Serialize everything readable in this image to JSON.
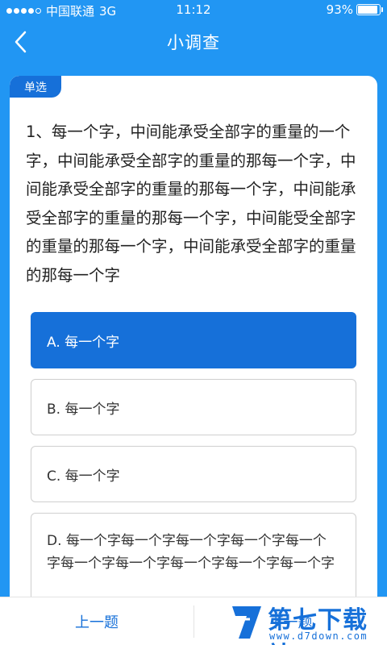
{
  "status_bar": {
    "carrier": "中国联通",
    "network": "3G",
    "time": "11:12",
    "battery": "93%",
    "battery_level": 0.93
  },
  "header": {
    "title": "小调查"
  },
  "question": {
    "type_tag": "单选",
    "text": "1、每一个字，中间能承受全部字的重量的一个字，中间能承受全部字的重量的那每一个字，中间能承受全部字的重量的那每一个字，中间能承受全部字的重量的那每一个字，中间能受全部字的重量的那每一个字，中间能承受全部字的重量的那每一个字"
  },
  "options": [
    {
      "label": "A. 每一个字",
      "selected": true
    },
    {
      "label": "B. 每一个字",
      "selected": false
    },
    {
      "label": "C. 每一个字",
      "selected": false
    },
    {
      "label": "D. 每一个字每一个字每一个字每一个字每一个字每一个字每一个字每一个字每一个字每一个字",
      "selected": false
    }
  ],
  "footer": {
    "prev_label": "上一题",
    "next_label": "下一题"
  },
  "watermark": {
    "title": "第七下载站",
    "url": "www.d7down.com"
  },
  "colors": {
    "primary": "#2196F3",
    "accent": "#1670D9"
  }
}
